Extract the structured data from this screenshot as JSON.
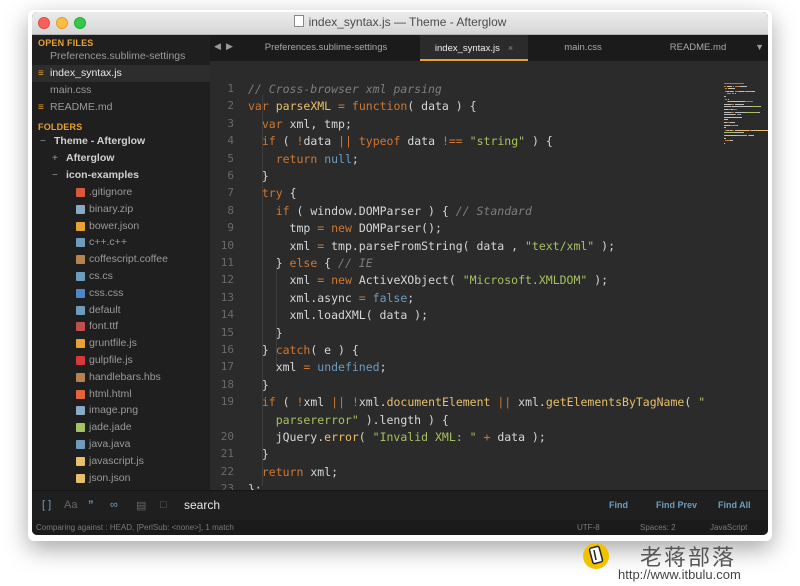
{
  "window": {
    "title": "index_syntax.js — Theme - Afterglow"
  },
  "sidebar": {
    "open_files_header": "OPEN FILES",
    "open_files": [
      {
        "label": "Preferences.sublime-settings",
        "modified": false,
        "active": false
      },
      {
        "label": "index_syntax.js",
        "modified": true,
        "active": true
      },
      {
        "label": "main.css",
        "modified": false,
        "active": false
      },
      {
        "label": "README.md",
        "modified": true,
        "active": false
      }
    ],
    "folders_header": "FOLDERS",
    "root_folder": "Theme - Afterglow",
    "subfolder_collapsed": "Afterglow",
    "subfolder_expanded": "icon-examples",
    "files": [
      {
        "name": ".gitignore",
        "icon": "git-icon",
        "color": "#d9583b"
      },
      {
        "name": "binary.zip",
        "icon": "zip-icon",
        "color": "#8aa9c8"
      },
      {
        "name": "bower.json",
        "icon": "bower-icon",
        "color": "#e8a135"
      },
      {
        "name": "c++.c++",
        "icon": "cpp-icon",
        "color": "#6d9cbe"
      },
      {
        "name": "coffescript.coffee",
        "icon": "coffee-icon",
        "color": "#b5834f"
      },
      {
        "name": "cs.cs",
        "icon": "csharp-icon",
        "color": "#6d9cbe"
      },
      {
        "name": "css.css",
        "icon": "css-icon",
        "color": "#4f86c6"
      },
      {
        "name": "default",
        "icon": "default-file-icon",
        "color": "#6d9cbe"
      },
      {
        "name": "font.ttf",
        "icon": "font-icon",
        "color": "#c0504d"
      },
      {
        "name": "gruntfile.js",
        "icon": "grunt-icon",
        "color": "#e8a135"
      },
      {
        "name": "gulpfile.js",
        "icon": "gulp-icon",
        "color": "#d9383b"
      },
      {
        "name": "handlebars.hbs",
        "icon": "handlebars-icon",
        "color": "#b5834f"
      },
      {
        "name": "html.html",
        "icon": "html-icon",
        "color": "#e4643a"
      },
      {
        "name": "image.png",
        "icon": "image-icon",
        "color": "#8aa9c8"
      },
      {
        "name": "jade.jade",
        "icon": "jade-icon",
        "color": "#a5c261"
      },
      {
        "name": "java.java",
        "icon": "java-icon",
        "color": "#6d9cbe"
      },
      {
        "name": "javascript.js",
        "icon": "js-icon",
        "color": "#e8bf6a"
      },
      {
        "name": "json.json",
        "icon": "json-icon",
        "color": "#e8bf6a"
      }
    ]
  },
  "tabs": [
    {
      "label": "Preferences.sublime-settings",
      "active": false
    },
    {
      "label": "index_syntax.js",
      "active": true
    },
    {
      "label": "main.css",
      "active": false
    },
    {
      "label": "README.md",
      "active": false
    }
  ],
  "tab_close": "×",
  "editor": {
    "line_numbers": [
      "1",
      "2",
      "3",
      "4",
      "5",
      "6",
      "7",
      "8",
      "9",
      "10",
      "11",
      "12",
      "13",
      "14",
      "15",
      "16",
      "17",
      "18",
      "19",
      "",
      "20",
      "21",
      "22",
      "23"
    ],
    "lines": [
      [
        [
          "cm",
          "// Cross-browser xml parsing"
        ]
      ],
      [
        [
          "kw",
          "var"
        ],
        [
          "tx",
          " "
        ],
        [
          "fn",
          "parseXML"
        ],
        [
          "tx",
          " "
        ],
        [
          "op",
          "="
        ],
        [
          "tx",
          " "
        ],
        [
          "kw",
          "function"
        ],
        [
          "tx",
          "( data ) {"
        ]
      ],
      [
        [
          "tx",
          "  "
        ],
        [
          "kw",
          "var"
        ],
        [
          "tx",
          " xml, tmp;"
        ]
      ],
      [
        [
          "tx",
          "  "
        ],
        [
          "kw",
          "if"
        ],
        [
          "tx",
          " ( "
        ],
        [
          "op",
          "!"
        ],
        [
          "tx",
          "data "
        ],
        [
          "op",
          "||"
        ],
        [
          "tx",
          " "
        ],
        [
          "kw",
          "typeof"
        ],
        [
          "tx",
          " data "
        ],
        [
          "op",
          "!=="
        ],
        [
          "tx",
          " "
        ],
        [
          "st",
          "\"string\""
        ],
        [
          "tx",
          " ) {"
        ]
      ],
      [
        [
          "tx",
          "    "
        ],
        [
          "kw",
          "return"
        ],
        [
          "tx",
          " "
        ],
        [
          "ct",
          "null"
        ],
        [
          "tx",
          ";"
        ]
      ],
      [
        [
          "tx",
          "  }"
        ]
      ],
      [
        [
          "tx",
          "  "
        ],
        [
          "kw",
          "try"
        ],
        [
          "tx",
          " {"
        ]
      ],
      [
        [
          "tx",
          "    "
        ],
        [
          "kw",
          "if"
        ],
        [
          "tx",
          " ( window.DOMParser ) { "
        ],
        [
          "cm",
          "// Standard"
        ]
      ],
      [
        [
          "tx",
          "      tmp "
        ],
        [
          "op",
          "="
        ],
        [
          "tx",
          " "
        ],
        [
          "kw",
          "new"
        ],
        [
          "tx",
          " DOMParser();"
        ]
      ],
      [
        [
          "tx",
          "      xml "
        ],
        [
          "op",
          "="
        ],
        [
          "tx",
          " tmp.parseFromString( data , "
        ],
        [
          "st",
          "\"text/xml\""
        ],
        [
          "tx",
          " );"
        ]
      ],
      [
        [
          "tx",
          "    } "
        ],
        [
          "kw",
          "else"
        ],
        [
          "tx",
          " { "
        ],
        [
          "cm",
          "// IE"
        ]
      ],
      [
        [
          "tx",
          "      xml "
        ],
        [
          "op",
          "="
        ],
        [
          "tx",
          " "
        ],
        [
          "kw",
          "new"
        ],
        [
          "tx",
          " ActiveXObject( "
        ],
        [
          "st",
          "\"Microsoft.XMLDOM\""
        ],
        [
          "tx",
          " );"
        ]
      ],
      [
        [
          "tx",
          "      xml.async "
        ],
        [
          "op",
          "="
        ],
        [
          "tx",
          " "
        ],
        [
          "ct",
          "false"
        ],
        [
          "tx",
          ";"
        ]
      ],
      [
        [
          "tx",
          "      xml.loadXML( data );"
        ]
      ],
      [
        [
          "tx",
          "    }"
        ]
      ],
      [
        [
          "tx",
          "  } "
        ],
        [
          "kw",
          "catch"
        ],
        [
          "tx",
          "( e ) {"
        ]
      ],
      [
        [
          "tx",
          "    xml "
        ],
        [
          "op",
          "="
        ],
        [
          "tx",
          " "
        ],
        [
          "ct",
          "undefined"
        ],
        [
          "tx",
          ";"
        ]
      ],
      [
        [
          "tx",
          "  }"
        ]
      ],
      [
        [
          "tx",
          "  "
        ],
        [
          "kw",
          "if"
        ],
        [
          "tx",
          " ( "
        ],
        [
          "op",
          "!"
        ],
        [
          "tx",
          "xml "
        ],
        [
          "op",
          "||"
        ],
        [
          "tx",
          " "
        ],
        [
          "op",
          "!"
        ],
        [
          "tx",
          "xml."
        ],
        [
          "fn",
          "documentElement"
        ],
        [
          "tx",
          " "
        ],
        [
          "op",
          "||"
        ],
        [
          "tx",
          " xml."
        ],
        [
          "fn",
          "getElementsByTagName"
        ],
        [
          "tx",
          "( "
        ],
        [
          "st",
          "\""
        ]
      ],
      [
        [
          "st",
          "    parsererror\""
        ],
        [
          "tx",
          " ).length ) {"
        ]
      ],
      [
        [
          "tx",
          "    jQuery."
        ],
        [
          "fn",
          "error"
        ],
        [
          "tx",
          "( "
        ],
        [
          "st",
          "\"Invalid XML: \""
        ],
        [
          "tx",
          " "
        ],
        [
          "op",
          "+"
        ],
        [
          "tx",
          " data );"
        ]
      ],
      [
        [
          "tx",
          "  }"
        ]
      ],
      [
        [
          "tx",
          "  "
        ],
        [
          "kw",
          "return"
        ],
        [
          "tx",
          " xml;"
        ]
      ],
      [
        [
          "tx",
          "};"
        ]
      ]
    ]
  },
  "findbar": {
    "icons": [
      "regex-icon",
      "case-sensitive-icon",
      "whole-word-icon",
      "wrap-icon",
      "in-selection-icon",
      "highlight-matches-icon"
    ],
    "query": "search",
    "buttons": {
      "find": "Find",
      "find_prev": "Find Prev",
      "find_all": "Find All"
    }
  },
  "statusbar": {
    "left": "Comparing against : HEAD, [PerlSub: <none>], 1 match",
    "encoding": "UTF-8",
    "indent": "Spaces: 2",
    "syntax": "JavaScript"
  },
  "watermark": {
    "text": "老蒋部落",
    "url": "http://www.itbulu.com"
  },
  "colors": {
    "accent": "#e8a135",
    "background": "#2b2b2b",
    "sidebar": "#1f1f1f",
    "keyword": "#cc7833",
    "function": "#e8bf6a",
    "string": "#a5c261",
    "constant": "#6d9cbe",
    "comment": "#7e7e7e"
  }
}
